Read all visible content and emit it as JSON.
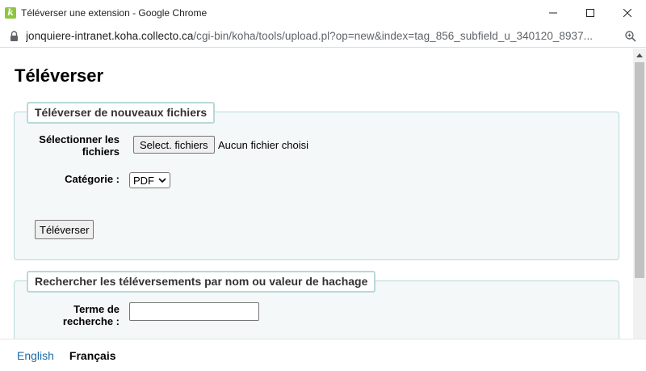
{
  "window": {
    "title": "Téléverser une extension - Google Chrome",
    "app_icon_letter": "k"
  },
  "addressbar": {
    "host": "jonquiere-intranet.koha.collecto.ca",
    "path": "/cgi-bin/koha/tools/upload.pl?op=new&index=tag_856_subfield_u_340120_8937..."
  },
  "page": {
    "title": "Téléverser"
  },
  "upload_section": {
    "legend": "Téléverser de nouveaux fichiers",
    "select_files_label_line1": "Sélectionner les",
    "select_files_label_line2": "fichiers",
    "file_button_label": "Select. fichiers",
    "file_status": "Aucun fichier choisi",
    "category_label": "Catégorie :",
    "category_value": "PDF",
    "submit_label": "Téléverser"
  },
  "search_section": {
    "legend": "Rechercher les téléversements par nom ou valeur de hachage",
    "term_label_line1": "Terme de",
    "term_label_line2": "recherche :",
    "term_value": ""
  },
  "footer": {
    "lang_english": "English",
    "lang_french": "Français"
  },
  "colors": {
    "fieldset_border": "#b9d8d9",
    "fieldset_bg": "#f4f8f9",
    "link": "#1f6ba6",
    "app_icon": "#8cc63f"
  }
}
